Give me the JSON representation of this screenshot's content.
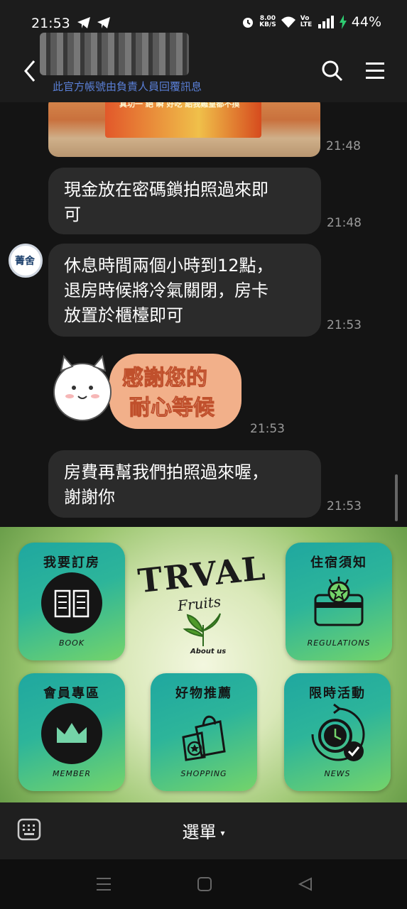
{
  "status_bar": {
    "time": "21:53",
    "network_speed_value": "8.00",
    "network_speed_unit": "KB/S",
    "volte": "Vo LTE",
    "battery": "44%"
  },
  "header": {
    "title": "",
    "subtitle": "此官方帳號由負責人員回覆訊息"
  },
  "messages": [
    {
      "type": "image",
      "time": "21:48",
      "image_text": "真功一 絕 瞬 好吃 給我雞皇都不換"
    },
    {
      "type": "text",
      "text": "現金放在密碼鎖拍照過來即可",
      "time": "21:48",
      "lines": [
        "現金放在密碼鎖拍照過來即",
        "可"
      ]
    },
    {
      "type": "text",
      "text": "休息時間兩個小時到12點，退房時候將冷氣關閉，房卡放置於櫃檯即可",
      "time": "21:53",
      "lines": [
        "休息時間兩個小時到12點，",
        "退房時候將冷氣關閉，房卡",
        "放置於櫃檯即可"
      ]
    },
    {
      "type": "sticker",
      "text": "感謝您的耐心等候",
      "lines": [
        "感謝您的",
        "耐心等候"
      ],
      "time": "21:53"
    },
    {
      "type": "text",
      "text": "房費再幫我們拍照過來喔，謝謝你",
      "time": "21:53",
      "lines": [
        "房費再幫我們拍照過來喔，",
        "謝謝你"
      ]
    }
  ],
  "avatar": {
    "text": "菁舍"
  },
  "rich_menu": {
    "brand_title": "TRVAL",
    "brand_subtitle": "Fruits",
    "brand_caption": "About us",
    "tiles": [
      {
        "label": "我要訂房",
        "sub": "BOOK",
        "icon": "book-icon"
      },
      {
        "label": "住宿須知",
        "sub": "REGULATIONS",
        "icon": "card-star-icon"
      },
      {
        "label": "會員專區",
        "sub": "MEMBER",
        "icon": "crown-icon"
      },
      {
        "label": "好物推薦",
        "sub": "SHOPPING",
        "icon": "shopping-bag-icon"
      },
      {
        "label": "限時活動",
        "sub": "NEWS",
        "icon": "clock-check-icon"
      }
    ]
  },
  "bottom_bar": {
    "menu_label": "選單",
    "caret": "▾"
  },
  "colors": {
    "background": "#141414",
    "bubble": "#2b2b2b",
    "timestamp": "#9a9a9a",
    "subtitle": "#5a7fd6"
  }
}
